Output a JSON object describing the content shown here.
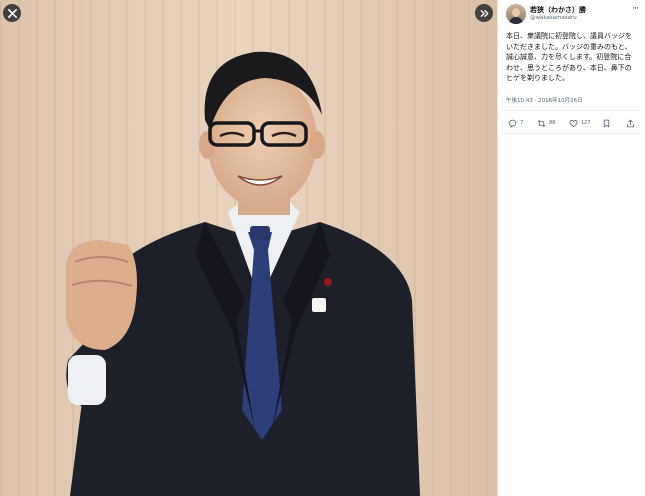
{
  "viewer": {
    "close_icon": "close-icon",
    "expand_icon": "double-chevron-right-icon"
  },
  "tweet": {
    "author_name": "若狭（わかさ）勝",
    "author_handle": "@wakasamasaru",
    "more_icon": "more-horizontal-icon",
    "text": "本日、衆議院に初登院し、議員バッジをいただきました。バッジの重みのもと、誠心誠意、力を尽くします。初登院に合わせ、思うところがあり、本日、鼻下のヒゲを剃りました。",
    "timestamp": "午後10:43 · 2016年10月26日",
    "actions": {
      "reply_count": "7",
      "retweet_count": "88",
      "like_count": "127"
    }
  }
}
